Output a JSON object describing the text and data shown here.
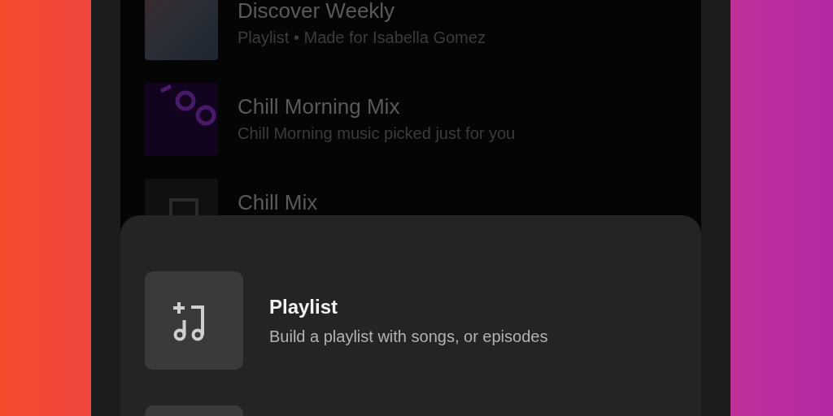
{
  "library": [
    {
      "kind": "discover",
      "title": "Discover Weekly",
      "subtitle": "Playlist • Made for Isabella Gomez"
    },
    {
      "kind": "mix",
      "title": "Chill Morning Mix",
      "subtitle": "Chill Morning music picked just for you"
    },
    {
      "kind": "blank",
      "title": "Chill Mix"
    }
  ],
  "sheet": {
    "options": [
      {
        "kind": "playlist",
        "title": "Playlist",
        "subtitle": "Build a playlist with songs, or episodes"
      },
      {
        "kind": "blank"
      }
    ]
  }
}
